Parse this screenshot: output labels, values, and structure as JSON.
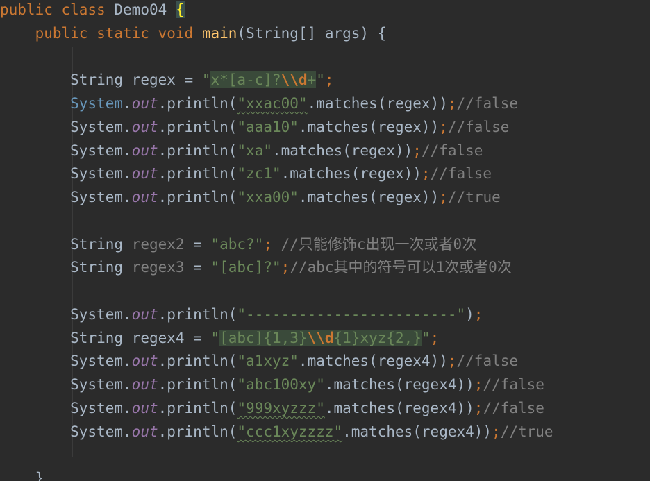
{
  "class_decl": {
    "kw_public": "public",
    "kw_class": "class",
    "name": "Demo04",
    "brace": "{"
  },
  "main_decl": {
    "kw_public": "public",
    "kw_static": "static",
    "kw_void": "void",
    "name": "main",
    "params": "(String[] args) {"
  },
  "regex1": {
    "type": "String",
    "name": "regex",
    "op": " = ",
    "q1": "\"",
    "p1": "x*",
    "p2": "[a-c]",
    "p3": "?",
    "p4": "\\\\d",
    "p5": "+",
    "q2": "\"",
    "semi": ";"
  },
  "calls1": [
    {
      "prefix": "System",
      "dot1": ".",
      "out": "out",
      "mid": ".println(",
      "arg": "\"xxac00\"",
      "call": ".matches(regex))",
      "semi": ";",
      "comment": "//false"
    },
    {
      "prefix": "System",
      "dot1": ".",
      "out": "out",
      "mid": ".println(",
      "arg": "\"aaa10\"",
      "call": ".matches(regex))",
      "semi": ";",
      "comment": "//false"
    },
    {
      "prefix": "System",
      "dot1": ".",
      "out": "out",
      "mid": ".println(",
      "arg": "\"xa\"",
      "call": ".matches(regex))",
      "semi": ";",
      "comment": "//false"
    },
    {
      "prefix": "System",
      "dot1": ".",
      "out": "out",
      "mid": ".println(",
      "arg": "\"zc1\"",
      "call": ".matches(regex))",
      "semi": ";",
      "comment": "//false"
    },
    {
      "prefix": "System",
      "dot1": ".",
      "out": "out",
      "mid": ".println(",
      "arg": "\"xxa00\"",
      "call": ".matches(regex))",
      "semi": ";",
      "comment": "//true"
    }
  ],
  "regex2": {
    "type": "String",
    "name": "regex2",
    "op": " = ",
    "value": "\"abc?\"",
    "semi": ";",
    "comment": " //只能修饰c出现一次或者0次"
  },
  "regex3": {
    "type": "String",
    "name": "regex3",
    "op": " = ",
    "value": "\"[abc]?\"",
    "semi": ";",
    "comment": "//abc其中的符号可以1次或者0次"
  },
  "separator": {
    "prefix": "System",
    "dot1": ".",
    "out": "out",
    "mid": ".println(",
    "arg": "\"------------------------\"",
    "close": ")",
    "semi": ";"
  },
  "regex4": {
    "type": "String",
    "name": "regex4",
    "op": " = ",
    "q1": "\"",
    "p1": "[abc]",
    "p2": "{1,3}",
    "p3": "\\\\d",
    "p4": "{1}",
    "p5": "xyz",
    "p6": "{2,}",
    "q2": "\"",
    "semi": ";"
  },
  "calls4": [
    {
      "prefix": "System",
      "dot1": ".",
      "out": "out",
      "mid": ".println(",
      "arg": "\"a1xyz\"",
      "call": ".matches(regex4))",
      "semi": ";",
      "comment": "//false"
    },
    {
      "prefix": "System",
      "dot1": ".",
      "out": "out",
      "mid": ".println(",
      "arg": "\"abc100xy\"",
      "call": ".matches(regex4))",
      "semi": ";",
      "comment": "//false"
    },
    {
      "prefix": "System",
      "dot1": ".",
      "out": "out",
      "mid": ".println(",
      "arg": "\"999xyzzz\"",
      "call": ".matches(regex4))",
      "semi": ";",
      "comment": "//false"
    },
    {
      "prefix": "System",
      "dot1": ".",
      "out": "out",
      "mid": ".println(",
      "arg": "\"ccc1xyzzzz\"",
      "call": ".matches(regex4))",
      "semi": ";",
      "comment": "//true"
    }
  ],
  "closing_brace": "}",
  "colors": {
    "background": "#2b2b2b",
    "keyword": "#cc7832",
    "method": "#ffc66d",
    "string": "#6a8759",
    "field": "#9876aa",
    "comment": "#808080",
    "text": "#a9b7c6",
    "system_highlight": "#6897bb"
  }
}
